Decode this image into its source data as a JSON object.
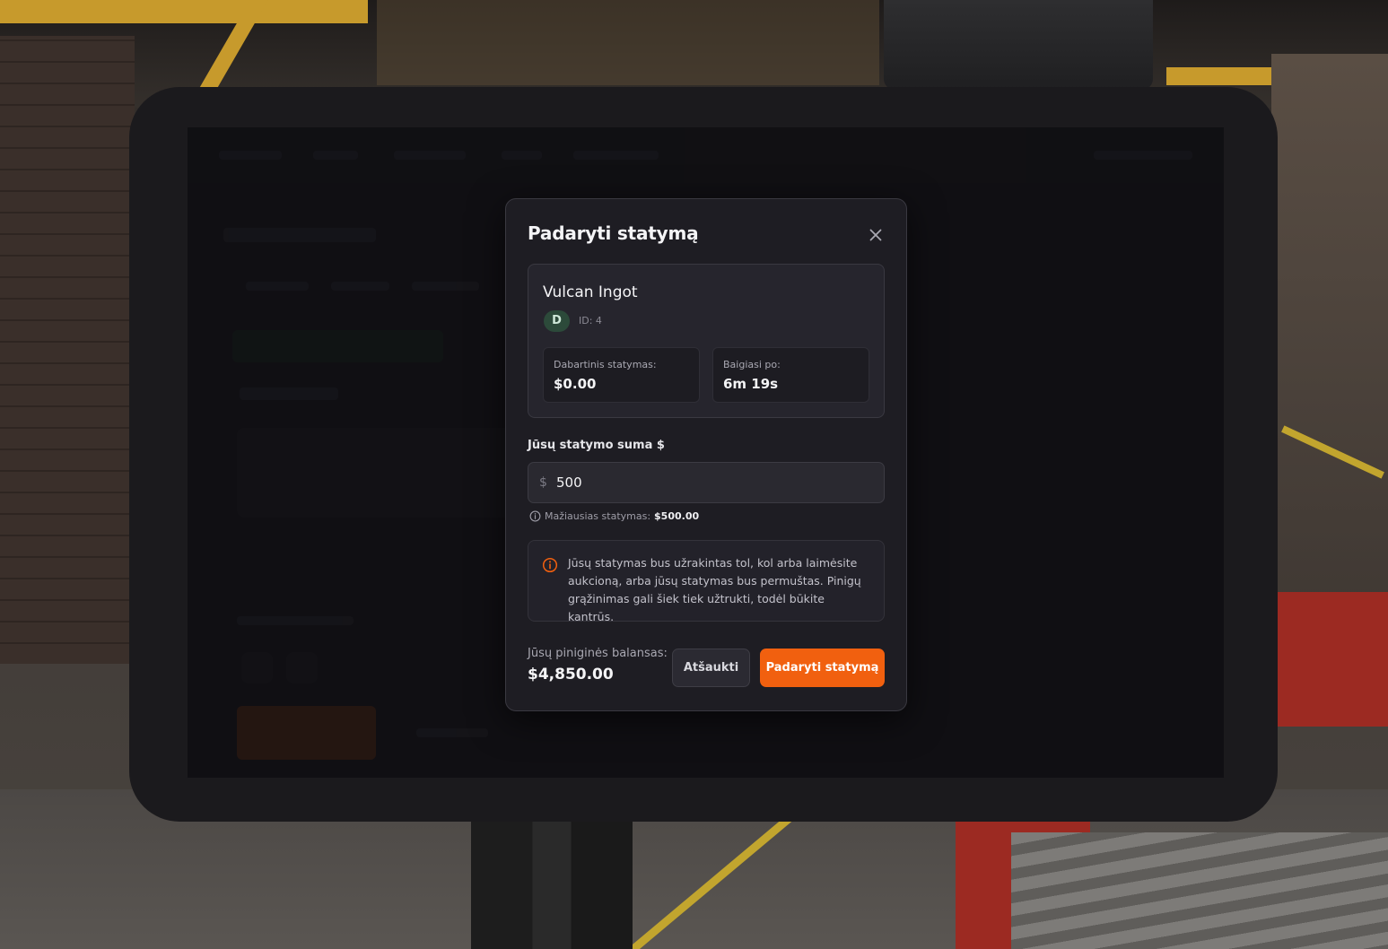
{
  "modal": {
    "title": "Padaryti statymą",
    "close_icon": "close-icon"
  },
  "item": {
    "name": "Vulcan Ingot",
    "grade": "D",
    "id_label": "ID: 4",
    "current_bid_label": "Dabartinis statymas:",
    "current_bid_value": "$0.00",
    "ends_in_label": "Baigiasi po:",
    "ends_in_value": "6m 19s"
  },
  "bid": {
    "amount_label": "Jūsų statymo suma $",
    "currency_symbol": "$",
    "amount_value": "500",
    "min_label": "Mažiausias statymas:",
    "min_value": "$500.00",
    "info_icon": "info-icon"
  },
  "notice": {
    "icon": "warning-circle-icon",
    "text": "Jūsų statymas bus užrakintas tol, kol arba laimėsite aukcioną, arba jūsų statymas bus permuštas. Pinigų grąžinimas gali šiek tiek užtrukti, todėl būkite kantrūs."
  },
  "footer": {
    "balance_label": "Jūsų piniginės balansas:",
    "balance_value": "$4,850.00",
    "cancel_label": "Atšaukti",
    "submit_label": "Padaryti statymą"
  },
  "colors": {
    "accent": "#f1600f",
    "modal_bg": "#1e1d23",
    "card_bg": "#26252d",
    "grade_badge_bg": "#2c4a3a",
    "notice_icon": "#f1600f"
  }
}
